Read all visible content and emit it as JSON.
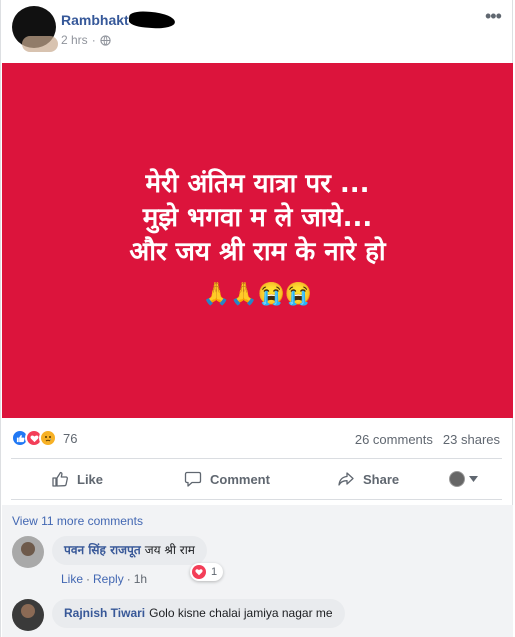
{
  "post": {
    "author": "Rambhakt",
    "time": "2 hrs",
    "image_text": [
      "मेरी अंतिम यात्रा पर ...",
      "मुझे भगवा म ले जाये...",
      "और जय श्री राम के नारे हो"
    ],
    "image_emojis": "🙏🙏😭😭",
    "image_bg": "#dc143c"
  },
  "stats": {
    "reaction_count": "76",
    "comments": "26 comments",
    "shares": "23 shares"
  },
  "actions": {
    "like": "Like",
    "comment": "Comment",
    "share": "Share"
  },
  "comments": {
    "view_more": "View 11 more comments",
    "items": [
      {
        "name": "पवन सिंह राजपूत",
        "text": "जय श्री राम",
        "like": "Like",
        "reply": "Reply",
        "time": "1h",
        "reaction_count": "1"
      },
      {
        "name": "Rajnish Tiwari",
        "text": "Golo kisne chalai jamiya nagar me"
      }
    ]
  }
}
